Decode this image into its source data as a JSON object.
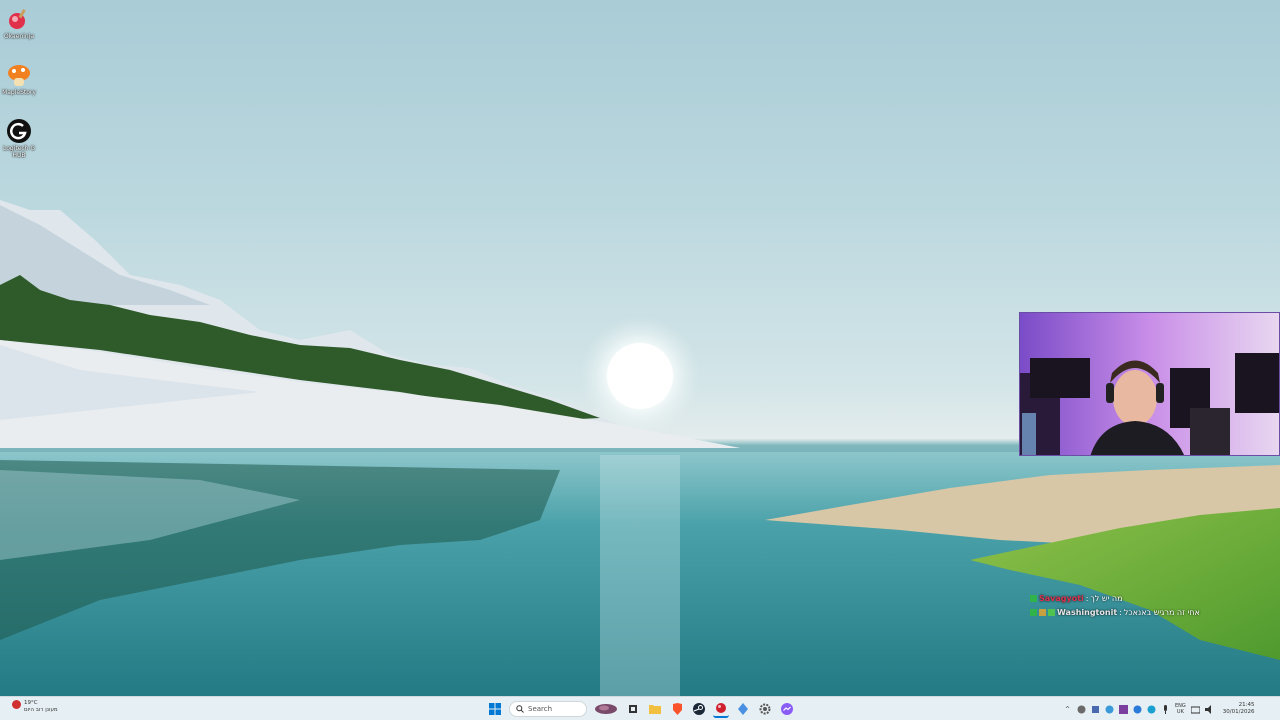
{
  "desktop": {
    "icons": [
      {
        "label": "Okaeninja",
        "icon": "app-icon-red-orb"
      },
      {
        "label": "MapleStory",
        "icon": "app-icon-mushroom"
      },
      {
        "label": "Logitech G HUB",
        "icon": "logitech-g-icon"
      }
    ]
  },
  "chat": {
    "messages": [
      {
        "user": "Savagyoti",
        "text": "מה יש לך",
        "user_color": "#e0314e"
      },
      {
        "user": "Washingtonit",
        "text": "אחי זה מרגיש באנאכל",
        "user_color": "#e6e6e6"
      }
    ]
  },
  "taskbar": {
    "weather": {
      "temp": "19°C",
      "desc": "מעונן רוב היום"
    },
    "search_placeholder": "Search",
    "apps": [
      "start-icon",
      "search",
      "widget-icon",
      "task-view-icon",
      "file-explorer-icon",
      "brave-icon",
      "steam-icon",
      "okaeninja-icon",
      "app-blue-icon",
      "settings-icon",
      "messenger-icon"
    ],
    "tray": {
      "language_top": "ENG",
      "language_bottom": "UK",
      "time": "21:45",
      "date": "30/01/2026"
    }
  },
  "colors": {
    "taskbar_bg": "#e6eff3",
    "accent": "#0078d4"
  }
}
